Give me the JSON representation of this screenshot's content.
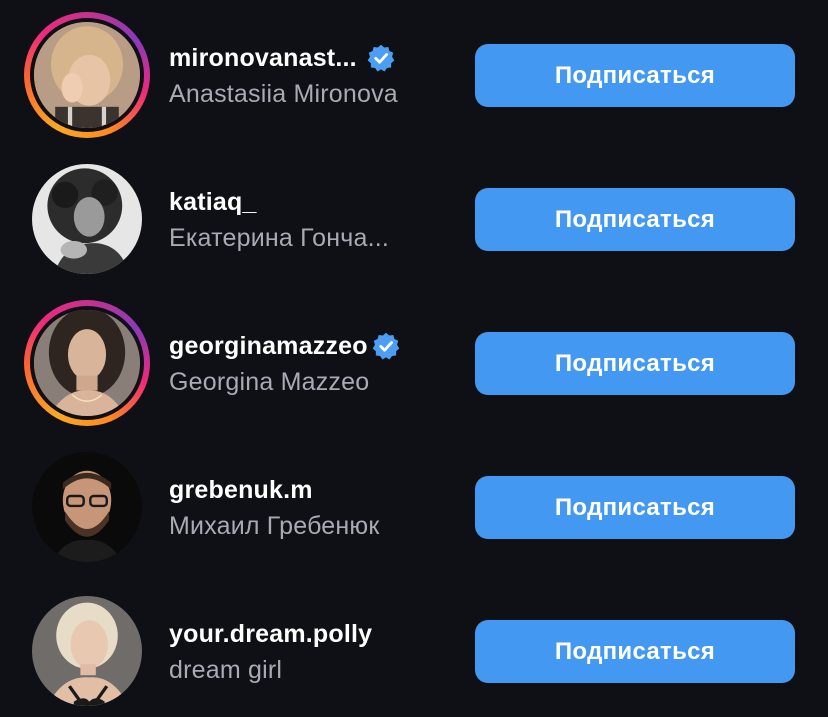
{
  "accent_color": "#4399f1",
  "background_color": "#0e1016",
  "suggestions": [
    {
      "username": "mironovanast...",
      "full_name": "Anastasiia Mironova",
      "verified": true,
      "story_ring": true,
      "avatar": "woman-light-hair-hand-on-face",
      "follow_label": "Подписаться"
    },
    {
      "username": "katiaq_",
      "full_name": "Екатерина Гонча...",
      "verified": false,
      "story_ring": false,
      "avatar": "woman-curly-hair-bw",
      "follow_label": "Подписаться"
    },
    {
      "username": "georginamazzeo",
      "full_name": "Georgina Mazzeo",
      "verified": true,
      "story_ring": true,
      "avatar": "woman-dark-hair-necklace",
      "follow_label": "Подписаться"
    },
    {
      "username": "grebenuk.m",
      "full_name": "Михаил Гребенюк",
      "verified": false,
      "story_ring": false,
      "avatar": "man-beard-glasses",
      "follow_label": "Подписаться"
    },
    {
      "username": "your.dream.polly",
      "full_name": "dream girl",
      "verified": false,
      "story_ring": false,
      "avatar": "woman-blonde-swimsuit",
      "follow_label": "Подписаться"
    }
  ]
}
